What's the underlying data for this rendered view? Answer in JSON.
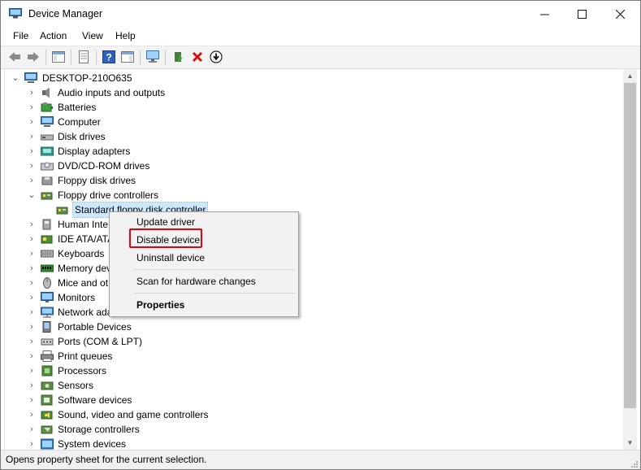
{
  "window": {
    "title": "Device Manager",
    "minimize": "—",
    "maximize": "☐",
    "close": "✕"
  },
  "menu": [
    "File",
    "Action",
    "View",
    "Help"
  ],
  "tree": {
    "root": "DESKTOP-210O635",
    "items": [
      {
        "label": "Audio inputs and outputs",
        "icon": "speaker-icon"
      },
      {
        "label": "Batteries",
        "icon": "battery-icon"
      },
      {
        "label": "Computer",
        "icon": "computer-icon"
      },
      {
        "label": "Disk drives",
        "icon": "disk-drive-icon"
      },
      {
        "label": "Display adapters",
        "icon": "display-adapter-icon"
      },
      {
        "label": "DVD/CD-ROM drives",
        "icon": "dvd-drive-icon"
      },
      {
        "label": "Floppy disk drives",
        "icon": "floppy-disk-icon"
      },
      {
        "label": "Floppy drive controllers",
        "icon": "controller-icon",
        "expanded": true
      },
      {
        "label": "Standard floppy disk controller",
        "icon": "controller-icon",
        "child": true,
        "selected": true
      },
      {
        "label": "Human Inte",
        "icon": "hid-icon"
      },
      {
        "label": "IDE ATA/ATA",
        "icon": "ide-controller-icon"
      },
      {
        "label": "Keyboards",
        "icon": "keyboard-icon"
      },
      {
        "label": "Memory dev",
        "icon": "memory-icon"
      },
      {
        "label": "Mice and ot",
        "icon": "mouse-icon"
      },
      {
        "label": "Monitors",
        "icon": "monitor-icon"
      },
      {
        "label": "Network ada",
        "icon": "network-adapter-icon"
      },
      {
        "label": "Portable Devices",
        "icon": "portable-device-icon"
      },
      {
        "label": "Ports (COM & LPT)",
        "icon": "port-icon"
      },
      {
        "label": "Print queues",
        "icon": "printer-icon"
      },
      {
        "label": "Processors",
        "icon": "processor-icon"
      },
      {
        "label": "Sensors",
        "icon": "sensor-icon"
      },
      {
        "label": "Software devices",
        "icon": "software-device-icon"
      },
      {
        "label": "Sound, video and game controllers",
        "icon": "sound-icon"
      },
      {
        "label": "Storage controllers",
        "icon": "storage-controller-icon"
      },
      {
        "label": "System devices",
        "icon": "system-device-icon"
      }
    ]
  },
  "context_menu": {
    "update": "Update driver",
    "disable": "Disable device",
    "uninstall": "Uninstall device",
    "scan": "Scan for hardware changes",
    "properties": "Properties"
  },
  "status": "Opens property sheet for the current selection.",
  "colors": {
    "highlight_box": "#e3000f",
    "selection": "#cce8ff",
    "accent": "#1a7fd4"
  }
}
